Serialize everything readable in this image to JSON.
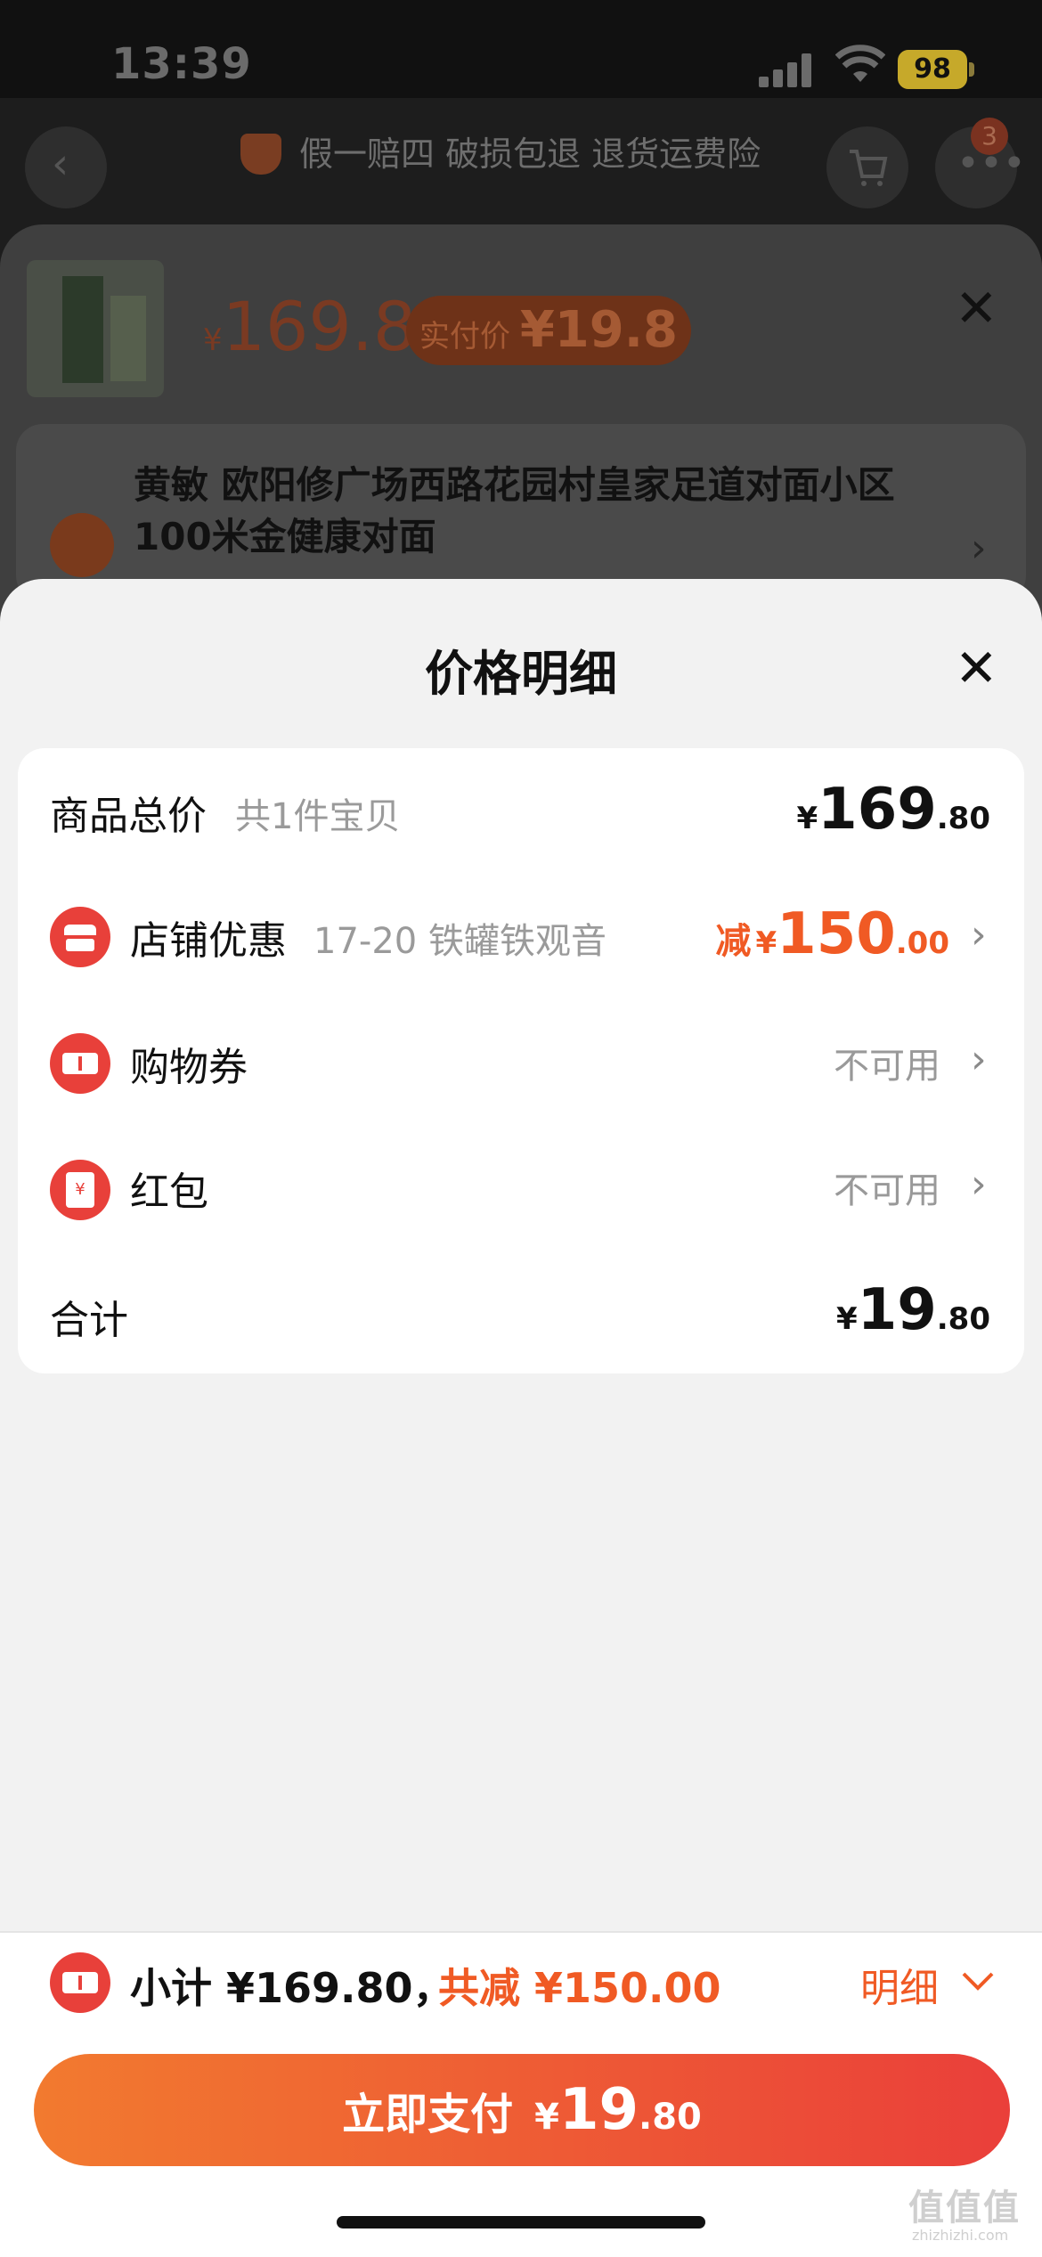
{
  "status_bar": {
    "time": "13:39",
    "battery": "98"
  },
  "background_page": {
    "guarantee_text": "假一赔四 破损包退 退货运费险",
    "cart_badge": "3"
  },
  "order_sheet": {
    "currency": "¥",
    "price": "169.8",
    "paid_label": "实付价",
    "paid_price": "¥19.8",
    "close_glyph": "✕",
    "address": "黄敏 欧阳修广场西路花园村皇家足道对面小区100米金健康对面"
  },
  "price_detail": {
    "title": "价格明细",
    "close_glyph": "✕",
    "rows": [
      {
        "label": "商品总价",
        "sub": "共1件宝贝",
        "currency": "¥",
        "int": "169",
        "dec": ".80"
      },
      {
        "label": "店铺优惠",
        "sub": "17-20 铁罐铁观音",
        "prefix": "减",
        "currency": "¥",
        "int": "150",
        "dec": ".00",
        "icon": "store-icon"
      },
      {
        "label": "购物券",
        "value": "不可用",
        "icon": "coupon-icon"
      },
      {
        "label": "红包",
        "value": "不可用",
        "icon": "red-packet-icon"
      },
      {
        "label": "合计",
        "currency": "¥",
        "int": "19",
        "dec": ".80"
      }
    ]
  },
  "bottom_bar": {
    "subtotal": "小计 ¥169.80，",
    "discount": "共减 ¥150.00",
    "detail": "明细",
    "pay_label": "立即支付",
    "pay_currency": "¥",
    "pay_int": "19",
    "pay_dec": ".80"
  },
  "watermark": {
    "text": "值值值",
    "url": "zhizhizhi.com"
  },
  "colors": {
    "accent": "#f05a24",
    "pay_start": "#f27a2f",
    "pay_end": "#ea3f3a",
    "icon_red": "#e8403a"
  }
}
